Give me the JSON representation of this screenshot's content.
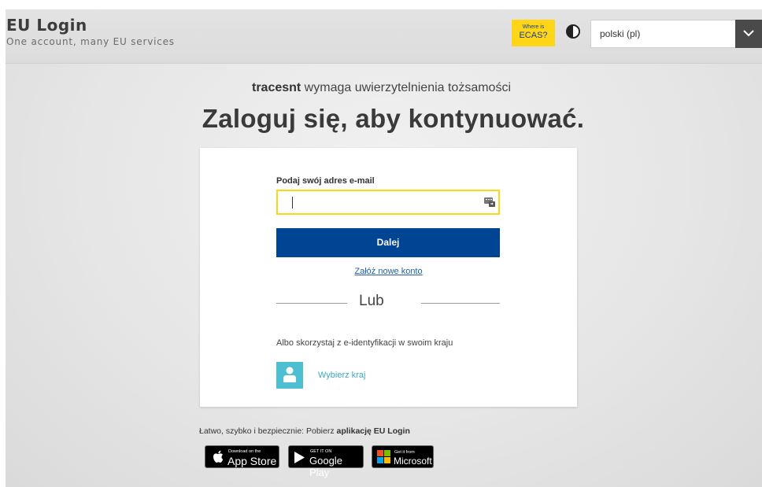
{
  "header": {
    "title": "EU Login",
    "subtitle": "One account, many EU services",
    "ecas_line1": "Where is",
    "ecas_line2": "ECAS?",
    "contrast_icon": "contrast-icon",
    "language": "polski (pl)"
  },
  "main": {
    "service_name": "tracesnt",
    "service_suffix": " wymaga uwierzytelnienia tożsamości",
    "title": "Zaloguj się, aby kontynuować."
  },
  "form": {
    "email_label": "Podaj swój adres e-mail",
    "email_value": "",
    "next_label": "Dalej",
    "create_account": "Załóż nowe konto",
    "or": "Lub",
    "eid_text": "Albo skorzystaj z e-identyfikacji w swoim kraju",
    "choose_country": "Wybierz kraj"
  },
  "apps": {
    "text_prefix": "Łatwo, szybko i bezpiecznie: Pobierz ",
    "text_bold": "aplikację EU Login",
    "appstore_small": "Download on the",
    "appstore_big": "App Store",
    "googleplay_small": "GET IT ON",
    "googleplay_big": "Google Play",
    "microsoft_small": "Get it from",
    "microsoft_big": "Microsoft"
  },
  "colors": {
    "primary": "#004494",
    "accent": "#ffd617",
    "link": "#2660a4",
    "eid": "#4ebfd0"
  }
}
